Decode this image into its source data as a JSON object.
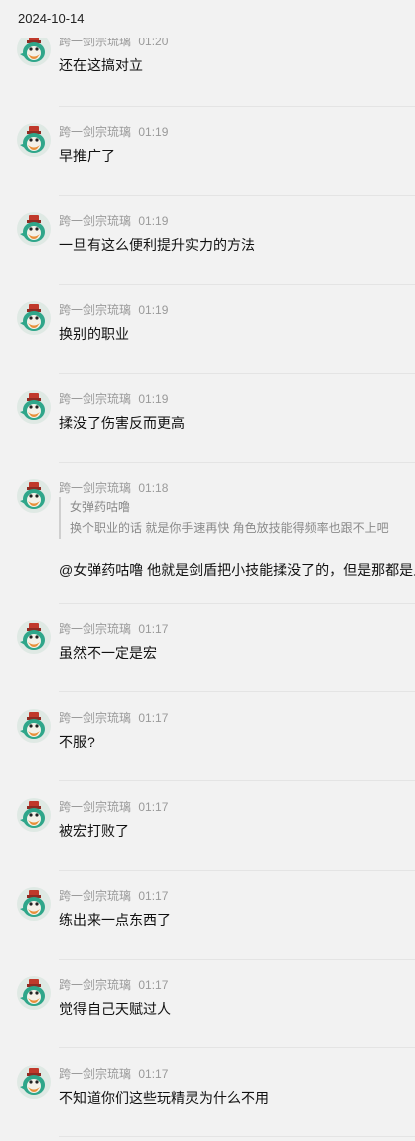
{
  "date_header": "2024-10-14",
  "messages": [
    {
      "user": "跨一剑宗琉璃",
      "time": "01:20",
      "text": "还在这搞对立"
    },
    {
      "user": "跨一剑宗琉璃",
      "time": "01:19",
      "text": "早推广了"
    },
    {
      "user": "跨一剑宗琉璃",
      "time": "01:19",
      "text": "一旦有这么便利提升实力的方法"
    },
    {
      "user": "跨一剑宗琉璃",
      "time": "01:19",
      "text": "换别的职业"
    },
    {
      "user": "跨一剑宗琉璃",
      "time": "01:19",
      "text": "揉没了伤害反而更高"
    },
    {
      "user": "跨一剑宗琉璃",
      "time": "01:18",
      "quote_author": "女弹药咕噜",
      "quote_text": "换个职业的话 就是你手速再快 角色放技能得频率也跟不上吧",
      "text": "@女弹药咕噜 他就是剑盾把小技能揉没了的，但是那都是人"
    },
    {
      "user": "跨一剑宗琉璃",
      "time": "01:17",
      "text": "虽然不一定是宏"
    },
    {
      "user": "跨一剑宗琉璃",
      "time": "01:17",
      "text": "不服?"
    },
    {
      "user": "跨一剑宗琉璃",
      "time": "01:17",
      "text": "被宏打败了"
    },
    {
      "user": "跨一剑宗琉璃",
      "time": "01:17",
      "text": "练出来一点东西了"
    },
    {
      "user": "跨一剑宗琉璃",
      "time": "01:17",
      "text": "觉得自己天赋过人"
    },
    {
      "user": "跨一剑宗琉璃",
      "time": "01:17",
      "text": "不知道你们这些玩精灵为什么不用"
    }
  ]
}
